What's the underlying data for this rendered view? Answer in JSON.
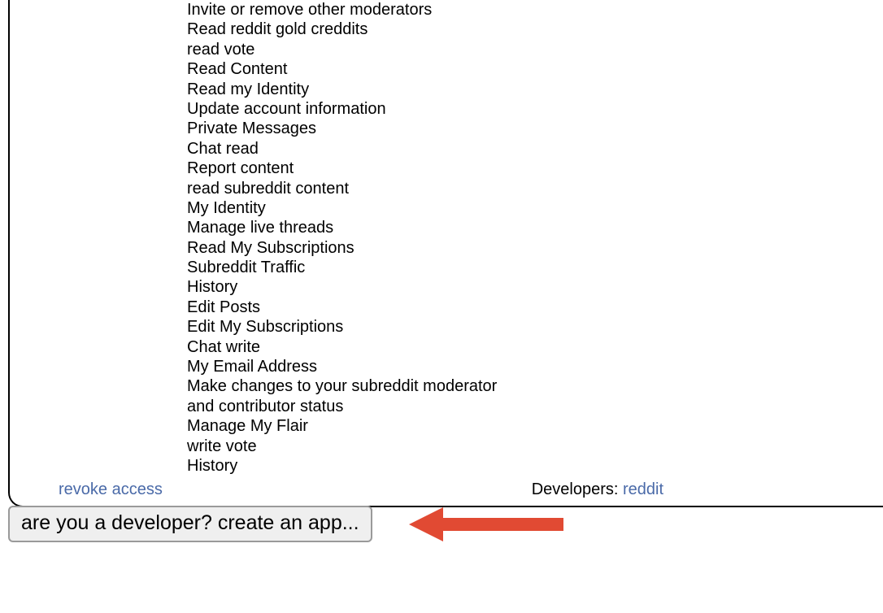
{
  "permissions": [
    "Invite or remove other moderators",
    "Read reddit gold creddits",
    "read vote",
    "Read Content",
    "Read my Identity",
    "Update account information",
    "Private Messages",
    "Chat read",
    "Report content",
    "read subreddit content",
    "My Identity",
    "Manage live threads",
    "Read My Subscriptions",
    "Subreddit Traffic",
    "History",
    "Edit Posts",
    "Edit My Subscriptions",
    "Chat write",
    "My Email Address",
    "Make changes to your subreddit moderator and contributor status",
    "Manage My Flair",
    "write vote",
    "History"
  ],
  "links": {
    "revoke": "revoke access",
    "developers_label": "Developers: ",
    "developer_name": "reddit"
  },
  "button": {
    "create_app": "are you a developer? create an app..."
  },
  "colors": {
    "link": "#4a6aa8",
    "arrow": "#e14a33"
  }
}
